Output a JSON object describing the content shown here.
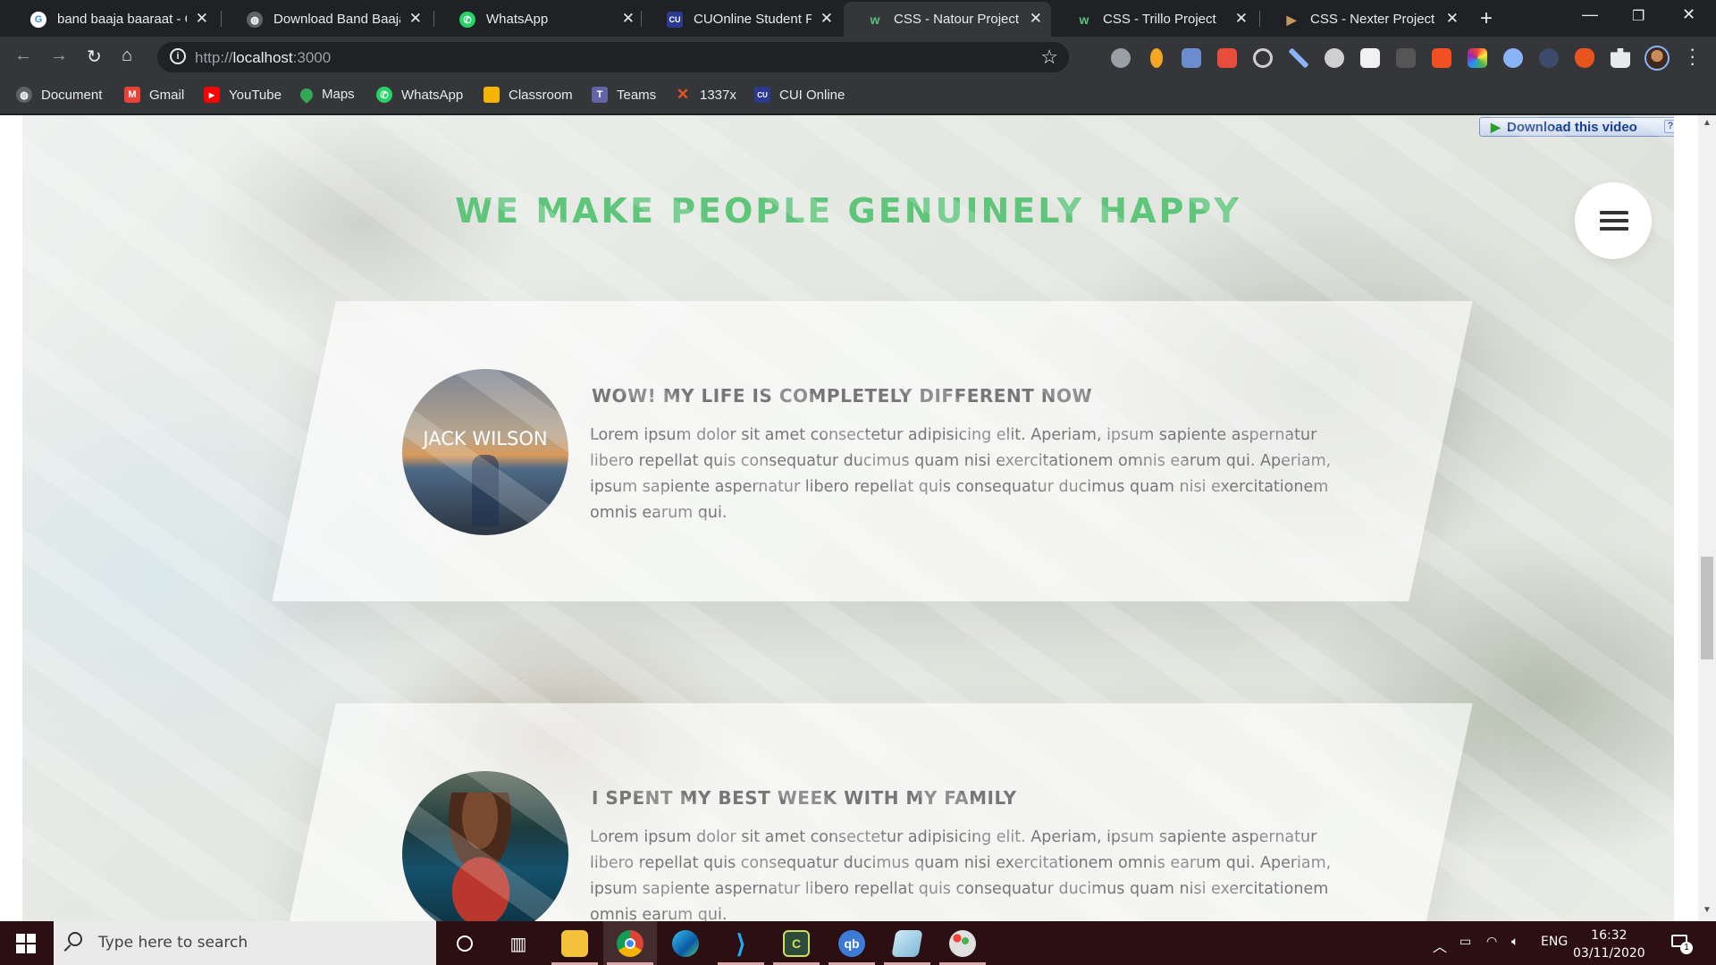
{
  "browser": {
    "tabs": [
      {
        "title": "band baaja baaraat - Google Search",
        "icon": "google-icon",
        "color": "#4285f4",
        "active": false
      },
      {
        "title": "Download Band Baaja Baaraat",
        "icon": "globe-icon",
        "color": "#5f6368",
        "active": false
      },
      {
        "title": "WhatsApp",
        "icon": "whatsapp-icon",
        "color": "#25d366",
        "active": false
      },
      {
        "title": "CUOnline Student Portal",
        "icon": "cui-icon",
        "color": "#2b3990",
        "active": false
      },
      {
        "title": "CSS - Natour Project",
        "icon": "natours-icon",
        "color": "#55c57a",
        "active": true
      },
      {
        "title": "CSS - Trillo Project",
        "icon": "natours-icon",
        "color": "#55c57a",
        "active": false
      },
      {
        "title": "CSS - Nexter Project",
        "icon": "nexter-icon",
        "color": "#c69963",
        "active": false
      }
    ],
    "address": {
      "scheme": "http://",
      "host": "localhost",
      "port": ":3000"
    },
    "bookmarks": [
      {
        "label": "Document",
        "icon": "globe-icon",
        "color": "#5f6368"
      },
      {
        "label": "Gmail",
        "icon": "gmail-icon",
        "color": "#ea4335"
      },
      {
        "label": "YouTube",
        "icon": "youtube-icon",
        "color": "#ff0000"
      },
      {
        "label": "Maps",
        "icon": "maps-icon",
        "color": "#34a853"
      },
      {
        "label": "WhatsApp",
        "icon": "whatsapp-icon",
        "color": "#25d366"
      },
      {
        "label": "Classroom",
        "icon": "classroom-icon",
        "color": "#f4b400"
      },
      {
        "label": "Teams",
        "icon": "teams-icon",
        "color": "#6264a7"
      },
      {
        "label": "1337x",
        "icon": "x-icon",
        "color": "#e8541d"
      },
      {
        "label": "CUI Online",
        "icon": "cui-icon",
        "color": "#2b3990"
      }
    ]
  },
  "page": {
    "download_bar": "Download this video",
    "section_heading": "WE MAKE PEOPLE GENUINELY HAPPY",
    "accent": "#55c57a",
    "stories": [
      {
        "caption": "Jack Wilson",
        "title": "WOW! MY LIFE IS COMPLETELY DIFFERENT NOW",
        "text": "Lorem ipsum dolor sit amet consectetur adipisicing elit. Aperiam, ipsum sapiente aspernatur libero repellat quis consequatur ducimus quam nisi exercitationem omnis earum qui. Aperiam, ipsum sapiente aspernatur libero repellat quis consequatur ducimus quam nisi exercitationem omnis earum qui."
      },
      {
        "caption": "",
        "title": "I SPENT MY BEST WEEK WITH MY FAMILY",
        "text": "Lorem ipsum dolor sit amet consectetur adipisicing elit. Aperiam, ipsum sapiente aspernatur libero repellat quis consequatur ducimus quam nisi exercitationem omnis earum qui. Aperiam, ipsum sapiente aspernatur libero repellat quis consequatur ducimus quam nisi exercitationem omnis earum qui."
      }
    ]
  },
  "taskbar": {
    "search_placeholder": "Type here to search",
    "apps": [
      "file-explorer-icon",
      "chrome-icon",
      "edge-icon",
      "vscode-icon",
      "cpanel-icon",
      "qbittorrent-icon",
      "notepad-icon",
      "paint-icon"
    ],
    "language": "ENG",
    "time": "16:32",
    "date": "03/11/2020",
    "notifications": "1"
  }
}
